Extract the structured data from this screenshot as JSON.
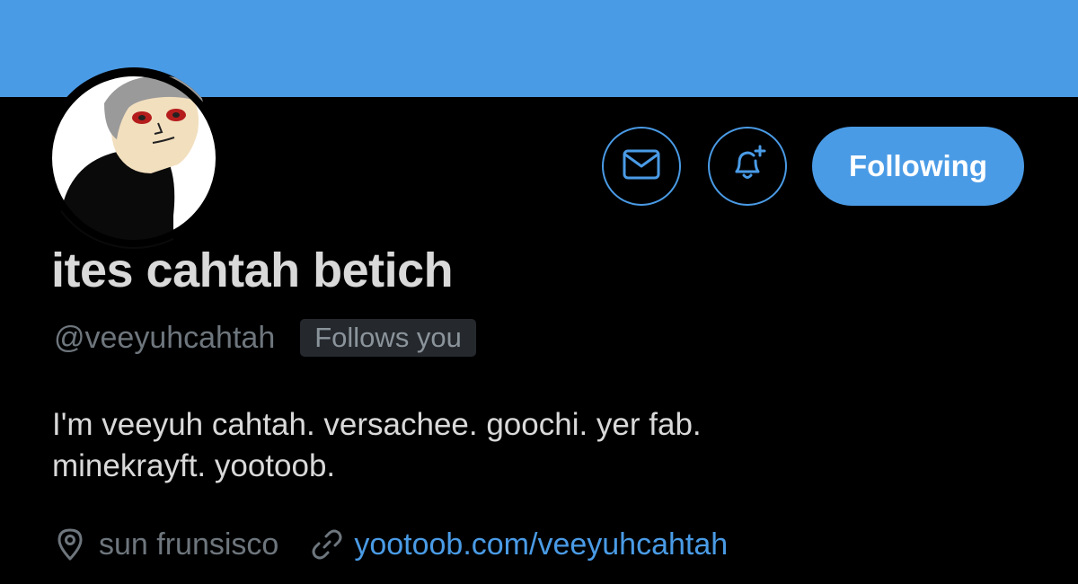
{
  "profile": {
    "display_name": "ites cahtah betich",
    "handle": "@veeyuhcahtah",
    "follows_badge": "Follows you",
    "bio_lines": [
      "I'm veeyuh cahtah. versachee. goochi. yer fab.",
      "minekrayft. yootoob."
    ],
    "location": "sun frunsisco",
    "url": "yootoob.com/veeyuhcahtah"
  },
  "actions": {
    "message_icon": "envelope-icon",
    "notify_icon": "bell-plus-icon",
    "follow_label": "Following"
  },
  "icons": {
    "location": "map-pin-icon",
    "link": "link-icon"
  },
  "colors": {
    "accent": "#4a9be6",
    "banner": "#4a9be6",
    "background": "#000000",
    "text_primary": "#d9d9d9",
    "text_secondary": "#6e767d",
    "badge_bg": "#25292e"
  }
}
